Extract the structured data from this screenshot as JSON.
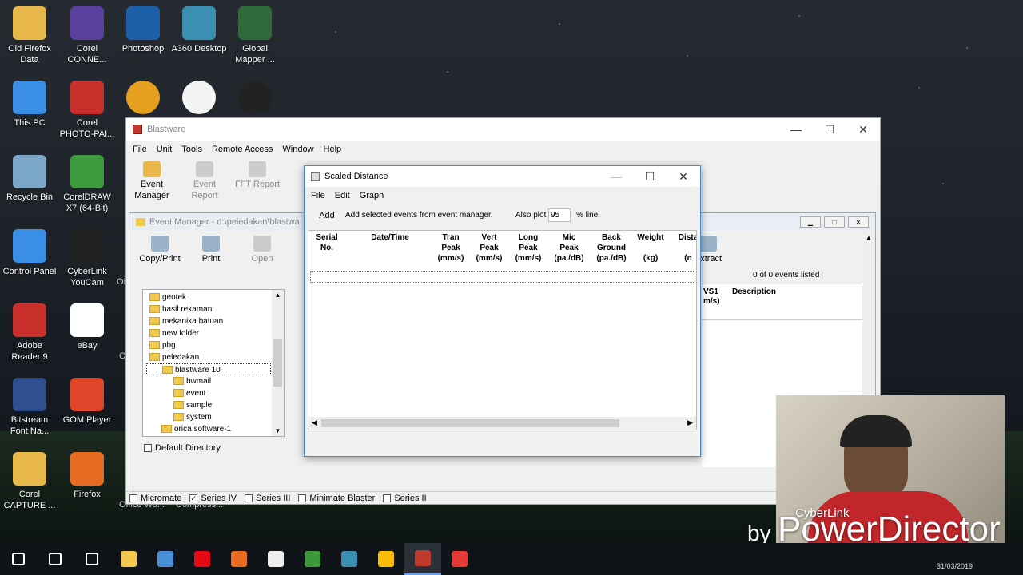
{
  "desktop": {
    "icons": [
      {
        "label": "Old Firefox Data",
        "color": "#e8b84a",
        "glyph": "folder-icon"
      },
      {
        "label": "Corel CONNE...",
        "color": "#5b3f9e",
        "glyph": "corel-connect-icon"
      },
      {
        "label": "Photoshop",
        "color": "#1d5fa8",
        "glyph": "photoshop-icon"
      },
      {
        "label": "A360 Desktop",
        "color": "#3b8fb0",
        "glyph": "a360-icon"
      },
      {
        "label": "Global Mapper ...",
        "color": "#2f6b3a",
        "glyph": "globe-icon"
      },
      {
        "label": "This PC",
        "color": "#3a8ee6",
        "glyph": "computer-icon"
      },
      {
        "label": "Corel PHOTO-PAI...",
        "color": "#c9302c",
        "glyph": "photopaint-icon"
      },
      {
        "label": "Recycle Bin",
        "color": "#7aa7c7",
        "glyph": "recycle-bin-icon"
      },
      {
        "label": "CorelDRAW X7 (64-Bit)",
        "color": "#3c9a3c",
        "glyph": "coreldraw-icon"
      },
      {
        "label": "Control Panel",
        "color": "#3a8ee6",
        "glyph": "control-panel-icon"
      },
      {
        "label": "CyberLink YouCam",
        "color": "#222",
        "glyph": "webcam-icon"
      },
      {
        "label": "Adobe Reader 9",
        "color": "#c9302c",
        "glyph": "pdf-icon"
      },
      {
        "label": "eBay",
        "color": "#fff",
        "glyph": "ebay-icon"
      },
      {
        "label": "Bitstream Font Na...",
        "color": "#2f4f8f",
        "glyph": "font-icon"
      },
      {
        "label": "GOM Player",
        "color": "#e0452a",
        "glyph": "gom-icon"
      },
      {
        "label": "Corel CAPTURE ...",
        "color": "#e8b84a",
        "glyph": "capture-icon"
      },
      {
        "label": "Firefox",
        "color": "#e66a1f",
        "glyph": "firefox-icon"
      }
    ],
    "row3_icons": [
      "autocad-icon",
      "document-icon",
      "recorder-icon"
    ],
    "partial_labels": [
      "Of",
      "O",
      "Office Wo...",
      "Compress..."
    ]
  },
  "blastware": {
    "title": "Blastware",
    "menu": [
      "File",
      "Unit",
      "Tools",
      "Remote Access",
      "Window",
      "Help"
    ],
    "toolbar": [
      {
        "label": "Event Manager",
        "enabled": true
      },
      {
        "label": "Event Report",
        "enabled": false
      },
      {
        "label": "FFT Report",
        "enabled": false
      }
    ],
    "status": [
      "Micromate",
      "Series IV",
      "Series III",
      "Minimate Blaster",
      "Series II"
    ]
  },
  "event_manager": {
    "title": "Event Manager - d:\\peledakan\\blastwa",
    "toolbar": [
      {
        "label": "Copy/Print",
        "enabled": true
      },
      {
        "label": "Print",
        "enabled": true
      },
      {
        "label": "Open",
        "enabled": false
      },
      {
        "label": "Extract",
        "enabled": true
      }
    ],
    "tree": [
      {
        "label": "geotek",
        "depth": 0,
        "open": false
      },
      {
        "label": "hasil rekaman",
        "depth": 0
      },
      {
        "label": "mekanika batuan",
        "depth": 0
      },
      {
        "label": "new folder",
        "depth": 0
      },
      {
        "label": "pbg",
        "depth": 0
      },
      {
        "label": "peledakan",
        "depth": 0,
        "open": true
      },
      {
        "label": "blastware 10",
        "depth": 1,
        "selected": true
      },
      {
        "label": "bwmail",
        "depth": 2
      },
      {
        "label": "event",
        "depth": 2
      },
      {
        "label": "sample",
        "depth": 2
      },
      {
        "label": "system",
        "depth": 2
      },
      {
        "label": "orica software-1",
        "depth": 1
      }
    ],
    "default_dir": "Default Directory",
    "events_listed": "0 of 0 events listed",
    "col_vs1": "VS1",
    "col_vs1_unit": "m/s)",
    "col_desc": "Description"
  },
  "dialog": {
    "title": "Scaled Distance",
    "menu": [
      "File",
      "Edit",
      "Graph"
    ],
    "add_label": "Add",
    "add_text": "Add selected events from event manager.",
    "also_plot": "Also plot",
    "plot_value": "95",
    "plot_suffix": "% line.",
    "columns": [
      {
        "l1": "Serial",
        "l2": "No.",
        "l3": ""
      },
      {
        "l1": "Date/Time",
        "l2": "",
        "l3": ""
      },
      {
        "l1": "Tran",
        "l2": "Peak",
        "l3": "(mm/s)"
      },
      {
        "l1": "Vert",
        "l2": "Peak",
        "l3": "(mm/s)"
      },
      {
        "l1": "Long",
        "l2": "Peak",
        "l3": "(mm/s)"
      },
      {
        "l1": "Mic",
        "l2": "Peak",
        "l3": "(pa./dB)"
      },
      {
        "l1": "Back",
        "l2": "Ground",
        "l3": "(pa./dB)"
      },
      {
        "l1": "Weight",
        "l2": "",
        "l3": "(kg)"
      },
      {
        "l1": "Dista",
        "l2": "",
        "l3": "(n"
      }
    ]
  },
  "overlay": {
    "brand": "CyberLink",
    "by": "by",
    "product": "PowerDirector",
    "date": "31/03/2019"
  },
  "taskbar": [
    "start-icon",
    "search-icon",
    "task-view-icon",
    "file-explorer-icon",
    "store-icon",
    "netflix-icon",
    "firefox-icon",
    "mail-icon",
    "app-icon",
    "search-app-icon",
    "chrome-icon",
    "blastware-icon",
    "recorder-icon"
  ]
}
